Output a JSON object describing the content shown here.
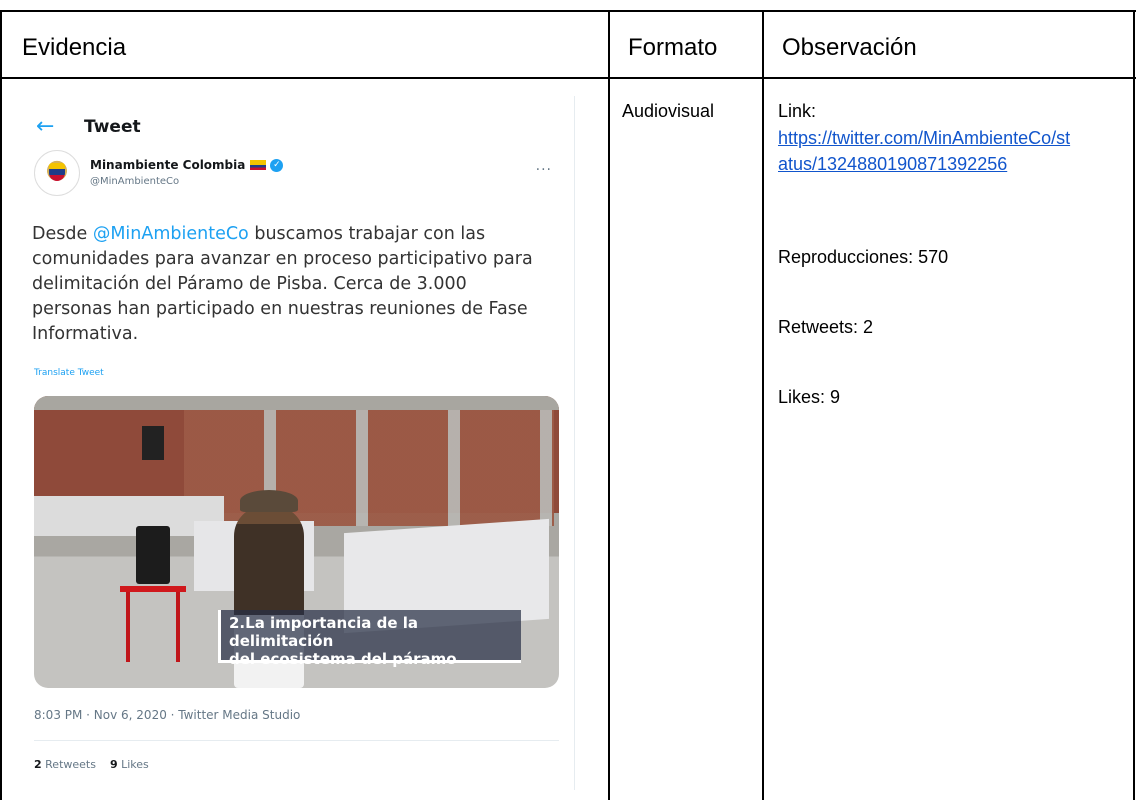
{
  "headers": {
    "evidencia": "Evidencia",
    "formato": "Formato",
    "observacion": "Observación"
  },
  "row": {
    "formato": "Audiovisual",
    "link_label": "Link:",
    "link_url": "https://twitter.com/MinAmbienteCo/status/1324880190871392256",
    "reproducciones": "Reproducciones: 570",
    "retweets": "Retweets: 2",
    "likes": "Likes: 9"
  },
  "tweet": {
    "header_title": "Tweet",
    "account_name": "Minambiente Colombia",
    "handle": "@MinAmbienteCo",
    "more": "···",
    "body_prefix": "Desde ",
    "mention": "@MinAmbienteCo",
    "body_rest": " buscamos trabajar con las comunidades para avanzar en proceso participativo para delimitación del Páramo de Pisba. Cerca de 3.000 personas han participado en nuestras reuniones de Fase Informativa.",
    "translate": "Translate Tweet",
    "video_caption_line1": "2.La importancia de la delimitación",
    "video_caption_line2": "del ecosistema del páramo",
    "meta": "8:03 PM · Nov 6, 2020 · Twitter Media Studio",
    "retweets_count": "2",
    "retweets_label": "Retweets",
    "likes_count": "9",
    "likes_label": "Likes"
  },
  "icons": {
    "back": "arrow-left-icon",
    "verified": "verified-badge-icon",
    "flag": "colombia-flag-icon"
  },
  "colors": {
    "link": "#1155cc",
    "twitter_blue": "#1da1f2"
  }
}
